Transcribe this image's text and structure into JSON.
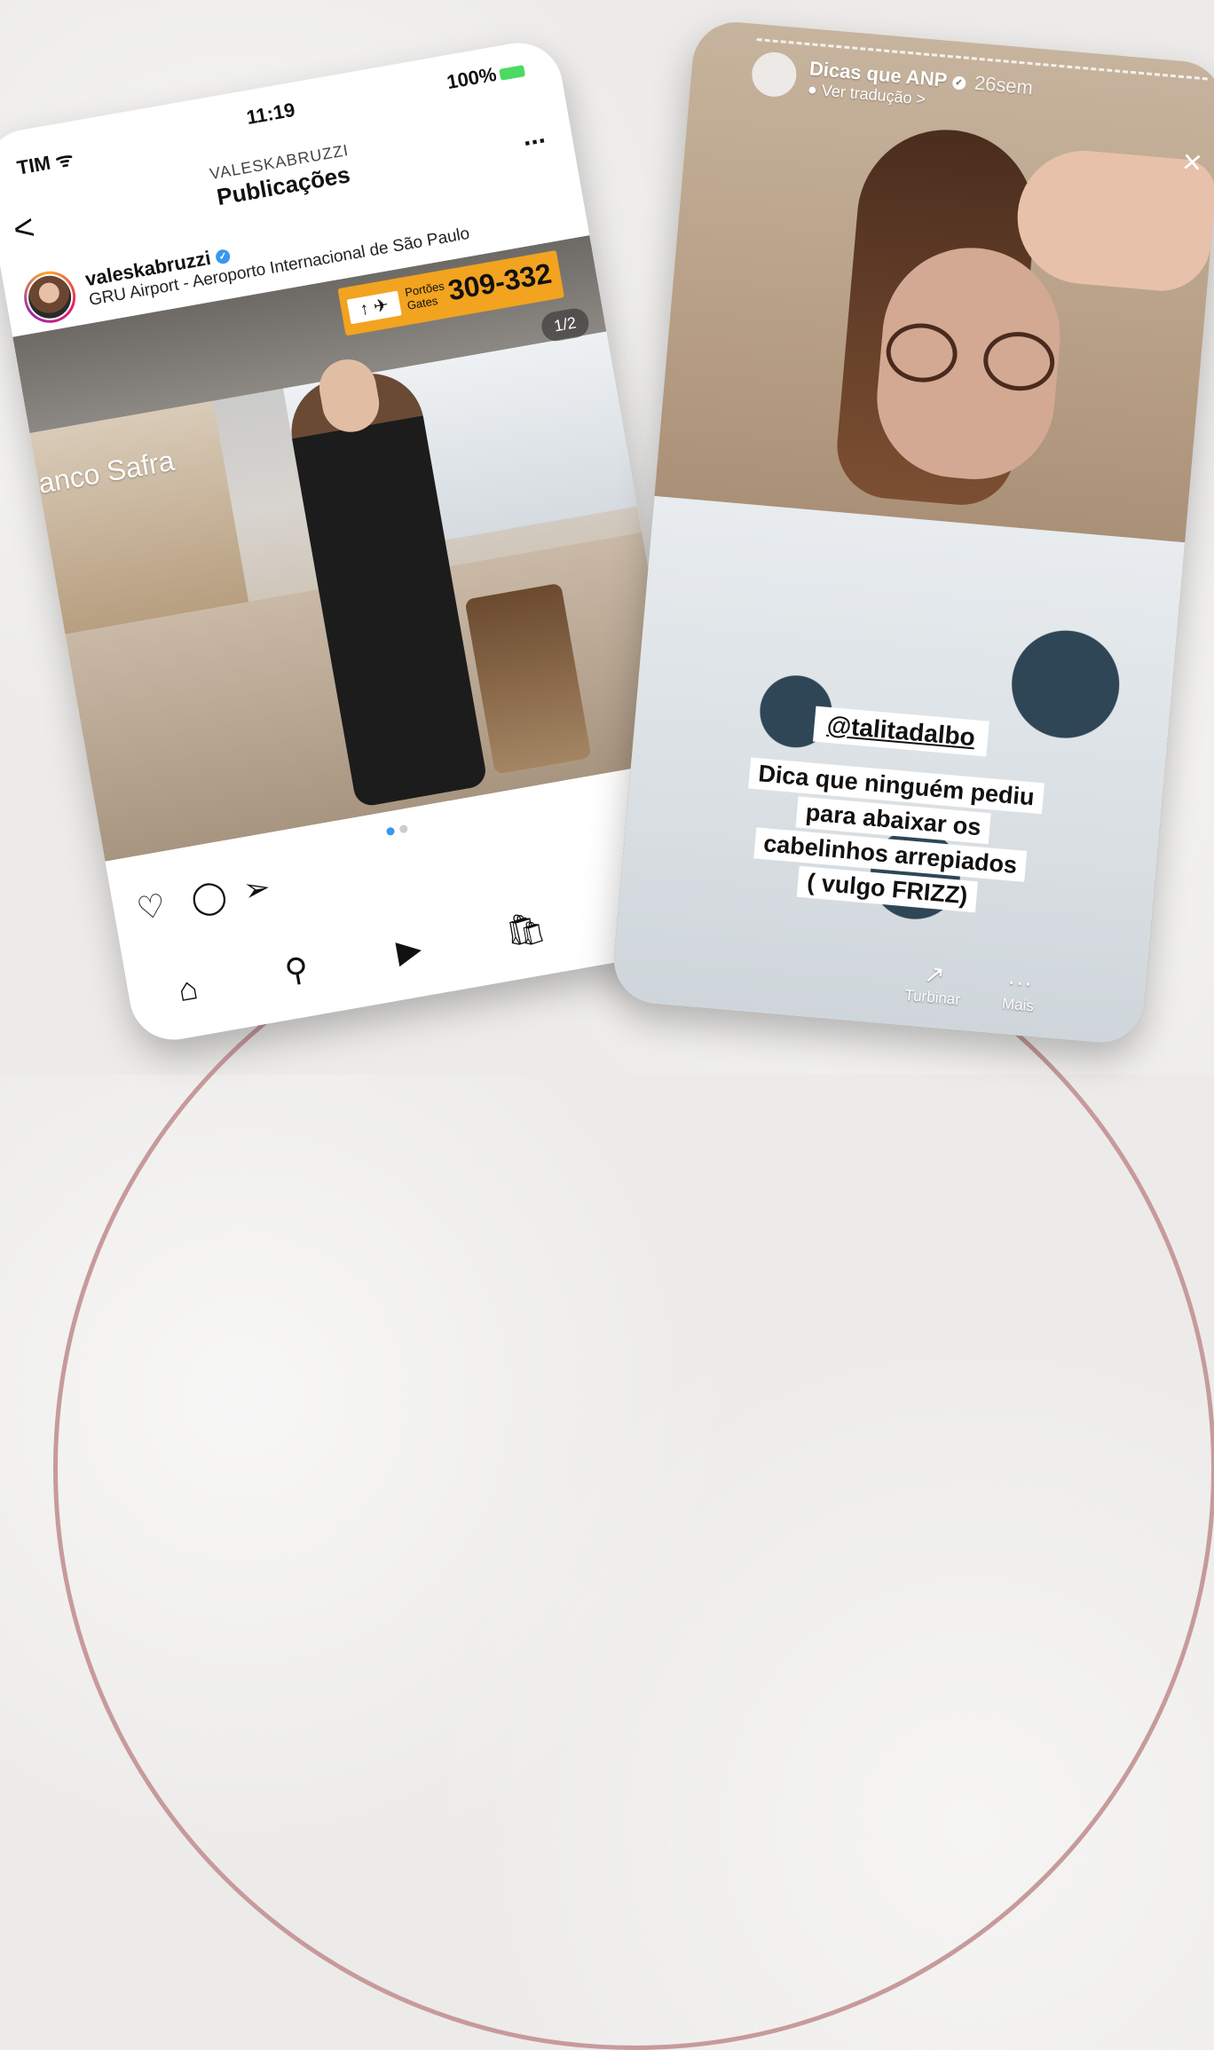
{
  "left_phone": {
    "status": {
      "carrier": "TIM",
      "signal_icon": "signal-wifi-icon",
      "time": "11:19",
      "battery": "100%"
    },
    "nav": {
      "username": "VALESKABRUZZI",
      "title": "Publicações",
      "back": "<",
      "more": "..."
    },
    "post": {
      "author": "valeskabruzzi",
      "location": "GRU Airport - Aeroporto Internacional de São Paulo",
      "counter": "1/2",
      "sign_text_pt": "Portões",
      "sign_text_en": "Gates",
      "sign_number": "309-332",
      "sign_arrows": "↑ ✈",
      "bank_sign": "anco Safra"
    },
    "actions": {
      "like": "♡",
      "comment": "◯",
      "share": "➢",
      "save": "⛉"
    },
    "tabs": {
      "home": "⌂",
      "search": "⚲",
      "reels": "▶",
      "shop": "🛍"
    }
  },
  "right_phone": {
    "account": "Dicas que ANP",
    "time_ago": "26sem",
    "translate": "Ver tradução >",
    "close": "×",
    "mention": "@talitadalbo",
    "caption_lines": [
      "Dica que ninguém pediu",
      "para abaixar os",
      "cabelinhos arrepiados",
      "( vulgo FRIZZ)"
    ],
    "bottom": {
      "boost_label": "Turbinar",
      "boost_icon": "↗",
      "more_label": "Mais",
      "more_icon": "···"
    }
  }
}
